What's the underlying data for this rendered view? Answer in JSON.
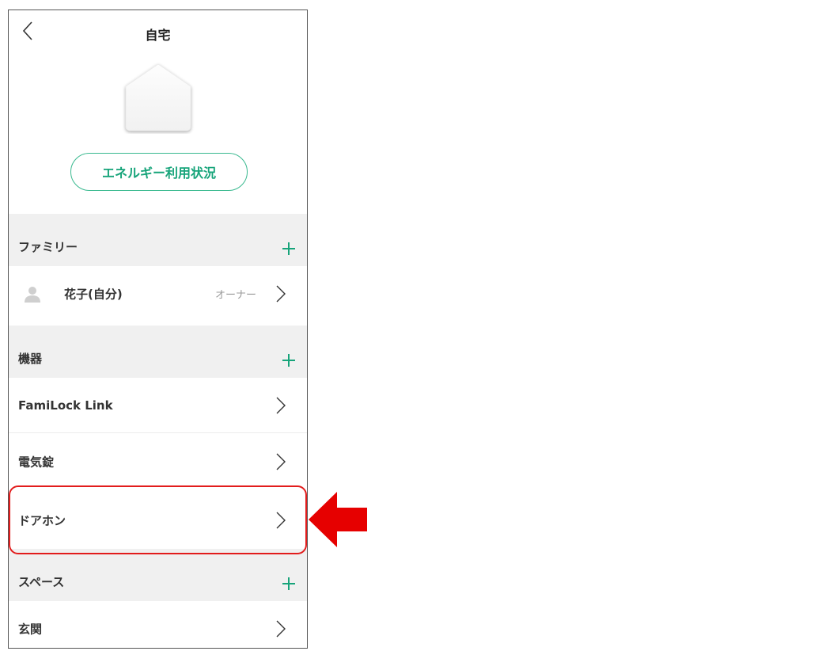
{
  "header": {
    "title": "自宅"
  },
  "energy_button_label": "エネルギー利用状況",
  "family": {
    "title": "ファミリー",
    "members": [
      {
        "name": "花子(自分)",
        "role": "オーナー"
      }
    ]
  },
  "devices": {
    "title": "機器",
    "items": [
      {
        "label": "FamiLock Link"
      },
      {
        "label": "電気錠"
      },
      {
        "label": "ドアホン"
      }
    ]
  },
  "spaces": {
    "title": "スペース",
    "items": [
      {
        "label": "玄関"
      }
    ]
  },
  "colors": {
    "accent": "#17a47a",
    "highlight": "#e21c1c",
    "section_bg": "#f0f0f0"
  },
  "icons": [
    "chevron-left-icon",
    "house-icon",
    "plus-icon",
    "avatar-icon",
    "chevron-right-icon",
    "red-arrow-icon"
  ]
}
